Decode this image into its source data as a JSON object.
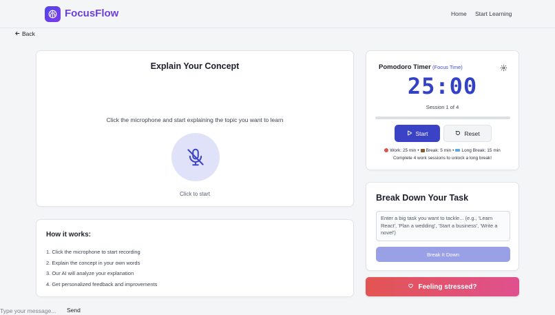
{
  "header": {
    "brand": "FocusFlow",
    "nav": [
      "Home",
      "Start Learning"
    ]
  },
  "back_label": "Back",
  "concept": {
    "title": "Explain Your Concept",
    "instruction": "Click the microphone and start explaining the topic you want to learn",
    "mic_status": "Click to start"
  },
  "how": {
    "title": "How it works:",
    "steps": [
      "1. Click the microphone to start recording",
      "2. Explain the concept in your own words",
      "3. Our AI will analyze your explanation",
      "4. Get personalized feedback and improvements"
    ]
  },
  "timer": {
    "title": "Pomodoro Timer",
    "mode": "(Focus Time)",
    "time": "25:00",
    "session": "Session 1 of 4",
    "progress": 0,
    "start_label": "Start",
    "reset_label": "Reset",
    "work": "Work: 25 min",
    "break": "Break: 5 min",
    "long_break": "Long Break: 15 min",
    "note": "Complete 4 work sessions to unlock a long break!"
  },
  "task": {
    "title": "Break Down Your Task",
    "placeholder": "Enter a big task you want to tackle... (e.g., 'Learn React', 'Plan a wedding', 'Start a business', 'Write a novel')",
    "button_label": "Break It Down"
  },
  "stressed_label": "Feeling stressed?",
  "message": {
    "placeholder": "Type your message...",
    "send_label": "Send"
  },
  "colors": {
    "brand": "#6d3fd8",
    "accent": "#3a43c6",
    "stress_gradient_start": "#e35552",
    "stress_gradient_end": "#e0508f"
  }
}
